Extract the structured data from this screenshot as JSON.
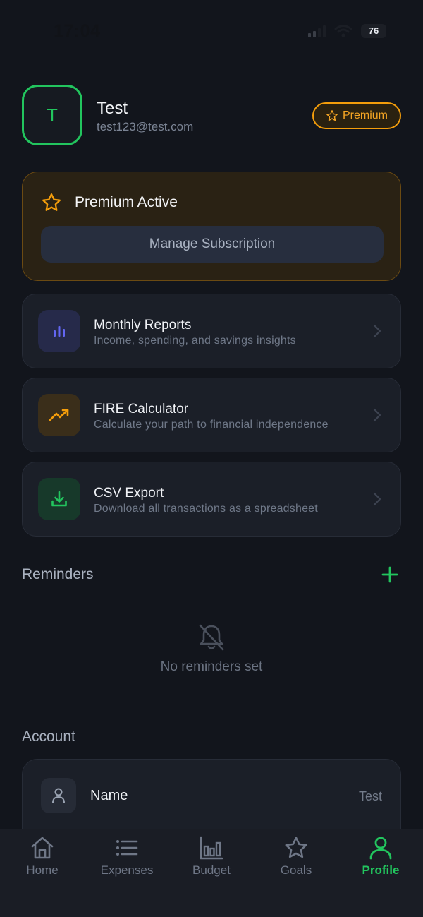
{
  "status_bar": {
    "time": "17:04",
    "battery": "76"
  },
  "profile": {
    "avatar_initial": "T",
    "name": "Test",
    "email": "test123@test.com",
    "badge_label": "Premium"
  },
  "premium_card": {
    "title": "Premium Active",
    "manage_label": "Manage Subscription"
  },
  "features": [
    {
      "title": "Monthly Reports",
      "subtitle": "Income, spending, and savings insights",
      "icon": "bar-chart-icon",
      "color": "#6366f1"
    },
    {
      "title": "FIRE Calculator",
      "subtitle": "Calculate your path to financial independence",
      "icon": "trending-up-icon",
      "color": "#f59e0b"
    },
    {
      "title": "CSV Export",
      "subtitle": "Download all transactions as a spreadsheet",
      "icon": "download-icon",
      "color": "#22c55e"
    }
  ],
  "reminders": {
    "title": "Reminders",
    "empty_text": "No reminders set"
  },
  "account": {
    "title": "Account",
    "items": [
      {
        "label": "Name",
        "value": "Test",
        "icon": "user-icon"
      }
    ]
  },
  "nav": {
    "items": [
      {
        "label": "Home",
        "icon": "home-icon",
        "active": false
      },
      {
        "label": "Expenses",
        "icon": "list-icon",
        "active": false
      },
      {
        "label": "Budget",
        "icon": "bar-chart-icon",
        "active": false
      },
      {
        "label": "Goals",
        "icon": "star-icon",
        "active": false
      },
      {
        "label": "Profile",
        "icon": "user-icon",
        "active": true
      }
    ]
  },
  "colors": {
    "accent": "#22c55e",
    "premium": "#f59e0b",
    "background": "#12151c",
    "card": "#1b1f28"
  }
}
